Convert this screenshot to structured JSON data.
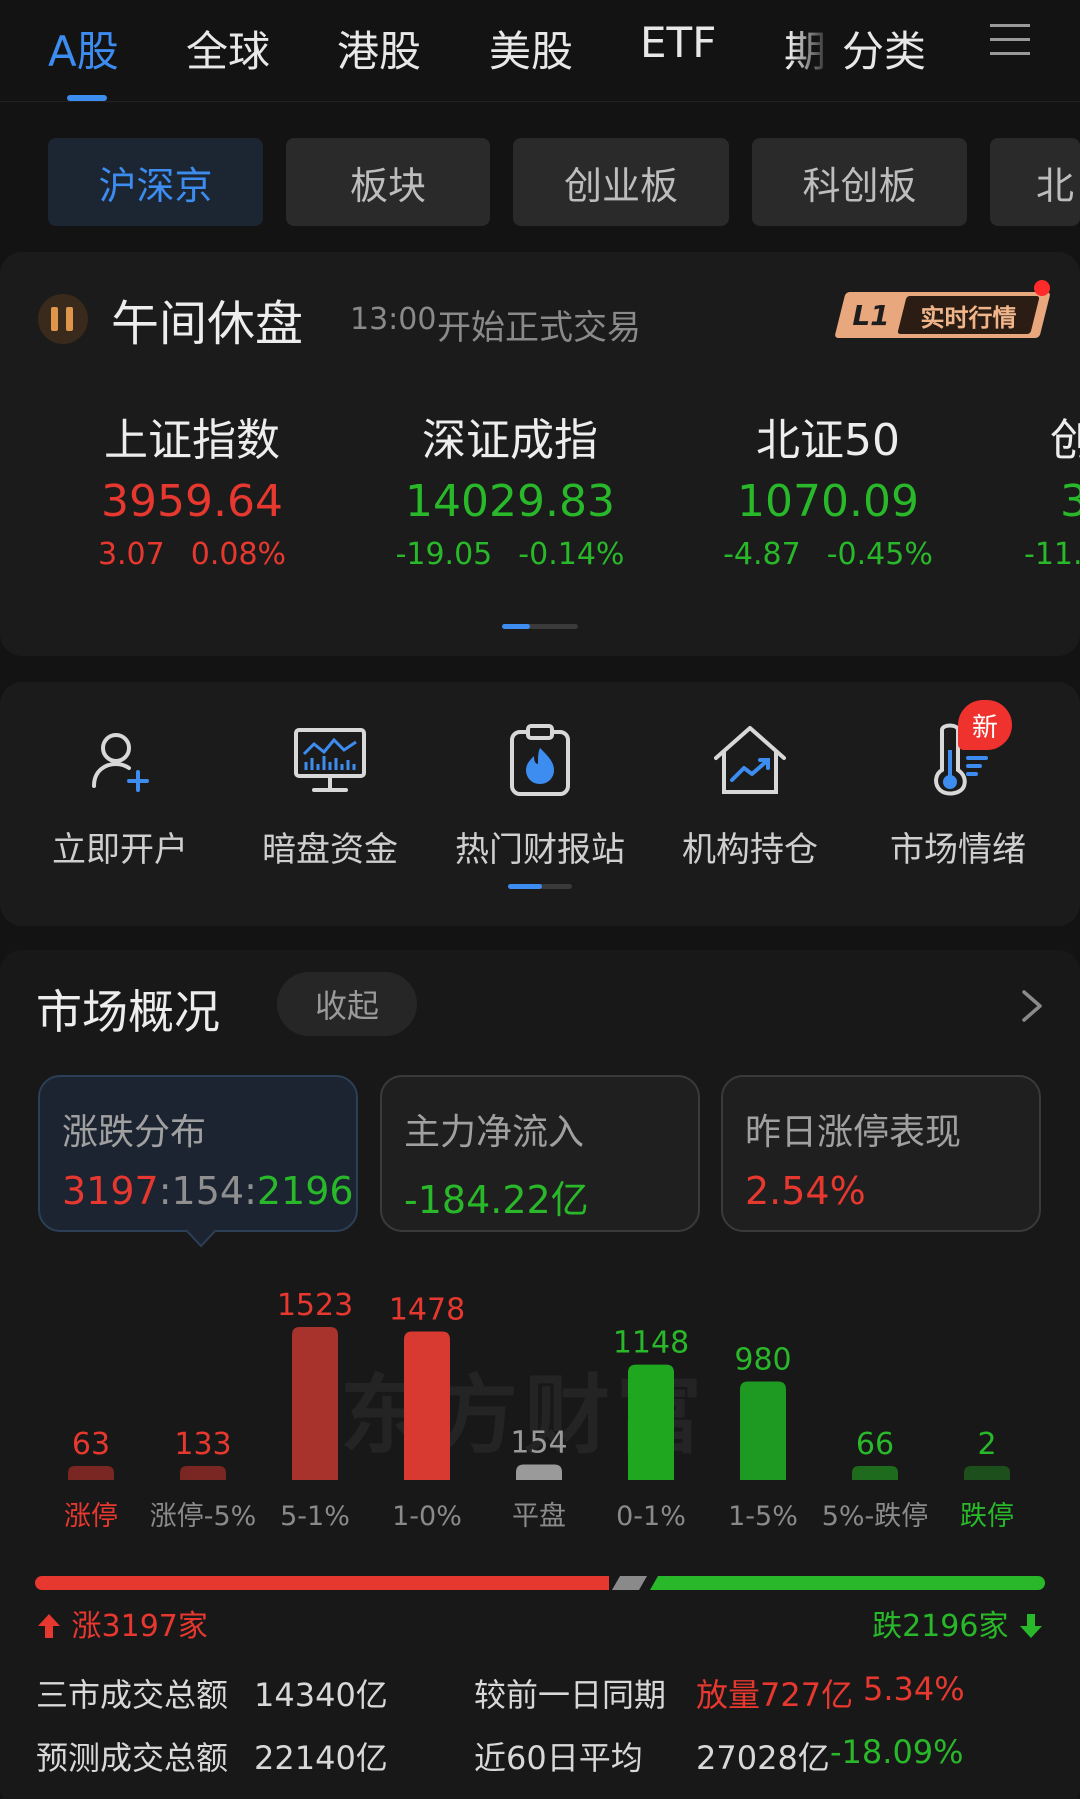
{
  "top_tabs": [
    {
      "label": "A股"
    },
    {
      "label": "全球"
    },
    {
      "label": "港股"
    },
    {
      "label": "美股"
    },
    {
      "label": "ETF"
    },
    {
      "label": "期"
    },
    {
      "label": "分类"
    }
  ],
  "menu_icon": "hamburger-menu-icon",
  "sub_tabs": [
    {
      "label": "沪深京"
    },
    {
      "label": "板块"
    },
    {
      "label": "创业板"
    },
    {
      "label": "科创板"
    },
    {
      "label": "北"
    }
  ],
  "session": {
    "title": "午间休盘",
    "time": "13:00",
    "desc": "开始正式交易",
    "badge_level": "L1",
    "badge_text": "实时行情"
  },
  "indices": [
    {
      "name": "上证指数",
      "value": "3959.64",
      "change": "3.07",
      "pct": "0.08%",
      "dir": "up"
    },
    {
      "name": "深证成指",
      "value": "14029.83",
      "change": "-19.05",
      "pct": "-0.14%",
      "dir": "down"
    },
    {
      "name": "北证50",
      "value": "1070.09",
      "change": "-4.87",
      "pct": "-0.45%",
      "dir": "down"
    },
    {
      "name": "创",
      "value": "3",
      "change": "-11.",
      "pct": "",
      "dir": "down"
    }
  ],
  "features": [
    {
      "label": "立即开户",
      "icon": "user-add-icon"
    },
    {
      "label": "暗盘资金",
      "icon": "monitor-chart-icon"
    },
    {
      "label": "热门财报站",
      "icon": "clipboard-fire-icon"
    },
    {
      "label": "机构持仓",
      "icon": "house-trend-icon"
    },
    {
      "label": "市场情绪",
      "icon": "thermometer-icon"
    }
  ],
  "new_badge": "新",
  "market": {
    "title": "市场概况",
    "collapse_label": "收起",
    "stats": [
      {
        "title": "涨跌分布",
        "up": "3197",
        "sep1": ":",
        "flat": "154",
        "sep2": ":",
        "down": "2196"
      },
      {
        "title": "主力净流入",
        "value": "-184.22亿"
      },
      {
        "title": "昨日涨停表现",
        "value": "2.54%"
      }
    ],
    "watermark": "东方财富",
    "up_label": "涨3197家",
    "down_label": "跌2196家",
    "volume": [
      {
        "label": "三市成交总额",
        "value": "14340亿",
        "label2": "较前一日同期",
        "value2": "放量727亿",
        "pct": "5.34%"
      },
      {
        "label": "预测成交总额",
        "value": "22140亿",
        "label2": "近60日平均",
        "value2": "27028亿",
        "pct": "-18.09%"
      }
    ]
  },
  "colors": {
    "up": "#e6382f",
    "down": "#28b829",
    "flat": "#8a8a8a",
    "accent": "#3d8cf0"
  },
  "chart_data": {
    "type": "bar",
    "categories": [
      "涨停",
      "涨停-5%",
      "5-1%",
      "1-0%",
      "平盘",
      "0-1%",
      "1-5%",
      "5%-跌停",
      "跌停"
    ],
    "values": [
      63,
      133,
      1523,
      1478,
      154,
      1148,
      980,
      66,
      2
    ],
    "colors": [
      "#7a2622",
      "#7a2622",
      "#a8332d",
      "#d83a32",
      "#9a9a9a",
      "#1fa81f",
      "#1e9a22",
      "#1e6b1e",
      "#1d4f1d"
    ],
    "label_colors": [
      "#e6382f",
      "#e6382f",
      "#e6382f",
      "#e6382f",
      "#9a9a9a",
      "#28b829",
      "#28b829",
      "#28b829",
      "#28b829"
    ],
    "category_label_colors": [
      "#e6382f",
      "#8a8a8a",
      "#8a8a8a",
      "#8a8a8a",
      "#8a8a8a",
      "#8a8a8a",
      "#8a8a8a",
      "#8a8a8a",
      "#28b829"
    ]
  }
}
